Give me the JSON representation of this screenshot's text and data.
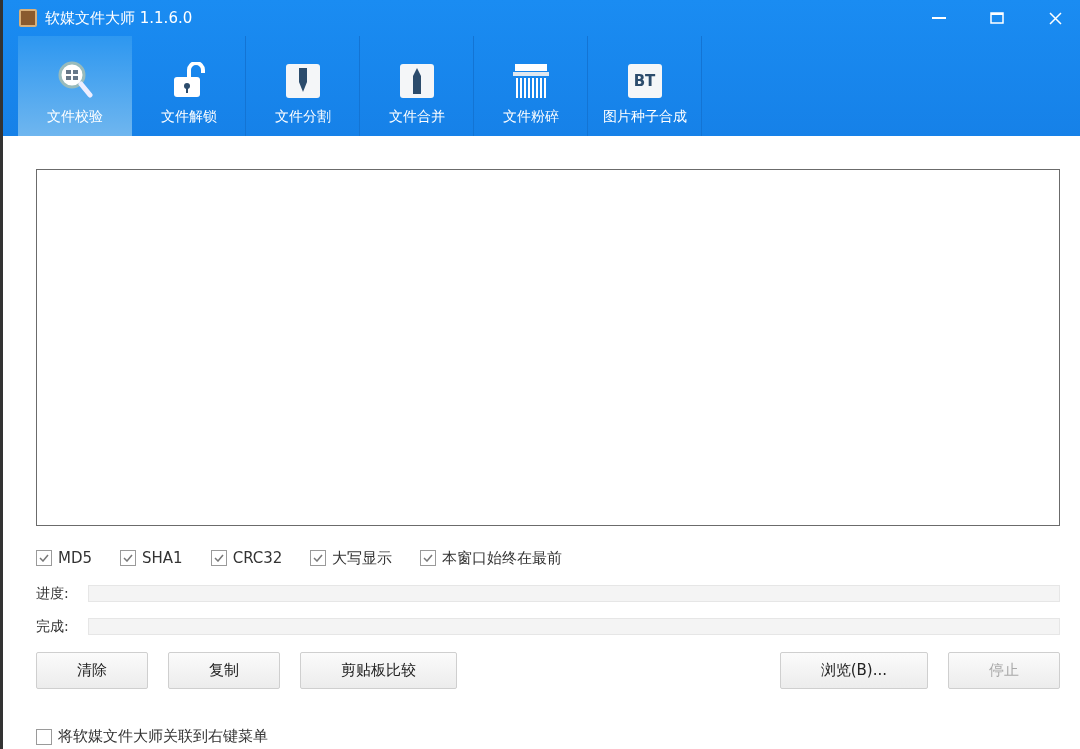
{
  "window": {
    "title": "软媒文件大师 1.1.6.0"
  },
  "tabs": [
    {
      "label": "文件校验",
      "kind": "verify",
      "selected": true
    },
    {
      "label": "文件解锁",
      "kind": "unlock",
      "selected": false
    },
    {
      "label": "文件分割",
      "kind": "split",
      "selected": false
    },
    {
      "label": "文件合并",
      "kind": "merge",
      "selected": false
    },
    {
      "label": "文件粉碎",
      "kind": "shred",
      "selected": false
    },
    {
      "label": "图片种子合成",
      "kind": "torrent",
      "icon_text": "BT",
      "selected": false
    }
  ],
  "options": [
    {
      "label": "MD5",
      "checked": true
    },
    {
      "label": "SHA1",
      "checked": true
    },
    {
      "label": "CRC32",
      "checked": true
    },
    {
      "label": "大写显示",
      "checked": true
    },
    {
      "label": "本窗口始终在最前",
      "checked": true
    }
  ],
  "progress": [
    {
      "label": "进度:"
    },
    {
      "label": "完成:"
    }
  ],
  "left_buttons": [
    {
      "label": "清除",
      "disabled": false
    },
    {
      "label": "复制",
      "disabled": false
    },
    {
      "label": "剪贴板比较",
      "disabled": false
    }
  ],
  "right_buttons": [
    {
      "label": "浏览(B)...",
      "disabled": false
    },
    {
      "label": "停止",
      "disabled": true
    }
  ],
  "context_menu_option": {
    "label": "将软媒文件大师关联到右键菜单",
    "checked": false
  }
}
